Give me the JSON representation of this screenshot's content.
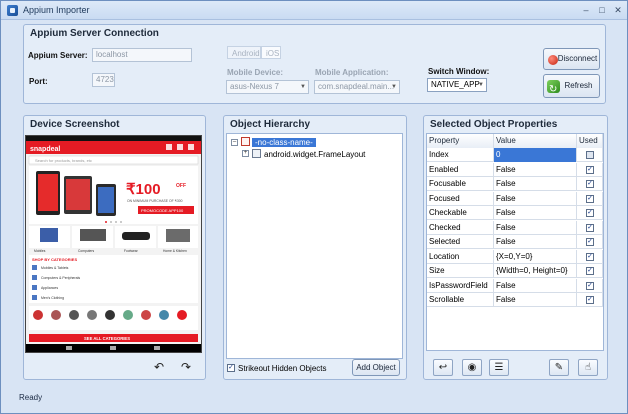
{
  "window": {
    "title": "Appium Importer"
  },
  "server": {
    "section_title": "Appium Server Connection",
    "server_label": "Appium Server:",
    "server_value": "localhost",
    "port_label": "Port:",
    "port_value": "4723",
    "tabs": [
      "Android",
      "iOS"
    ],
    "device_label": "Mobile Device:",
    "device_value": "asus-Nexus 7",
    "app_label": "Mobile Application:",
    "app_value": "com.snapdeal.main...",
    "switch_label": "Switch Window:",
    "switch_value": "NATIVE_APP",
    "disconnect_label": "Disconnect",
    "refresh_label": "Refresh"
  },
  "screenshot": {
    "section_title": "Device Screenshot",
    "app": {
      "brand": "snapdeal",
      "search_placeholder": "Search for products, brands, etc",
      "banner_amount": "₹100",
      "banner_off": "OFF",
      "banner_line": "ON MINIMUM PURCHASE OF ₹300",
      "promo": "PROMOCODE APP100",
      "categories_short": [
        "Mobiles",
        "Computers",
        "Footwear",
        "Home & Kitchen"
      ],
      "shop_title": "SHOP BY CATEGORIES",
      "shop_items": [
        "Mobiles & Tablets",
        "Computers & Peripherals",
        "Appliances",
        "Men's Clothing"
      ],
      "all_categories": "SEE ALL CATEGORIES"
    }
  },
  "hierarchy": {
    "section_title": "Object Hierarchy",
    "nodes": [
      "-no-class-name-",
      "android.widget.FrameLayout"
    ],
    "strikeout_label": "Strikeout Hidden Objects",
    "add_label": "Add Object"
  },
  "properties": {
    "section_title": "Selected Object Properties",
    "columns": [
      "Property",
      "Value",
      "Used"
    ],
    "rows": [
      {
        "name": "Index",
        "value": "0",
        "used": false
      },
      {
        "name": "Enabled",
        "value": "False",
        "used": true
      },
      {
        "name": "Focusable",
        "value": "False",
        "used": true
      },
      {
        "name": "Focused",
        "value": "False",
        "used": true
      },
      {
        "name": "Checkable",
        "value": "False",
        "used": true
      },
      {
        "name": "Checked",
        "value": "False",
        "used": true
      },
      {
        "name": "Selected",
        "value": "False",
        "used": true
      },
      {
        "name": "Location",
        "value": "{X=0,Y=0}",
        "used": true
      },
      {
        "name": "Size",
        "value": "{Width=0, Height=0}",
        "used": true
      },
      {
        "name": "IsPasswordField",
        "value": "False",
        "used": true
      },
      {
        "name": "Scrollable",
        "value": "False",
        "used": true
      }
    ]
  },
  "status": {
    "text": "Ready"
  }
}
